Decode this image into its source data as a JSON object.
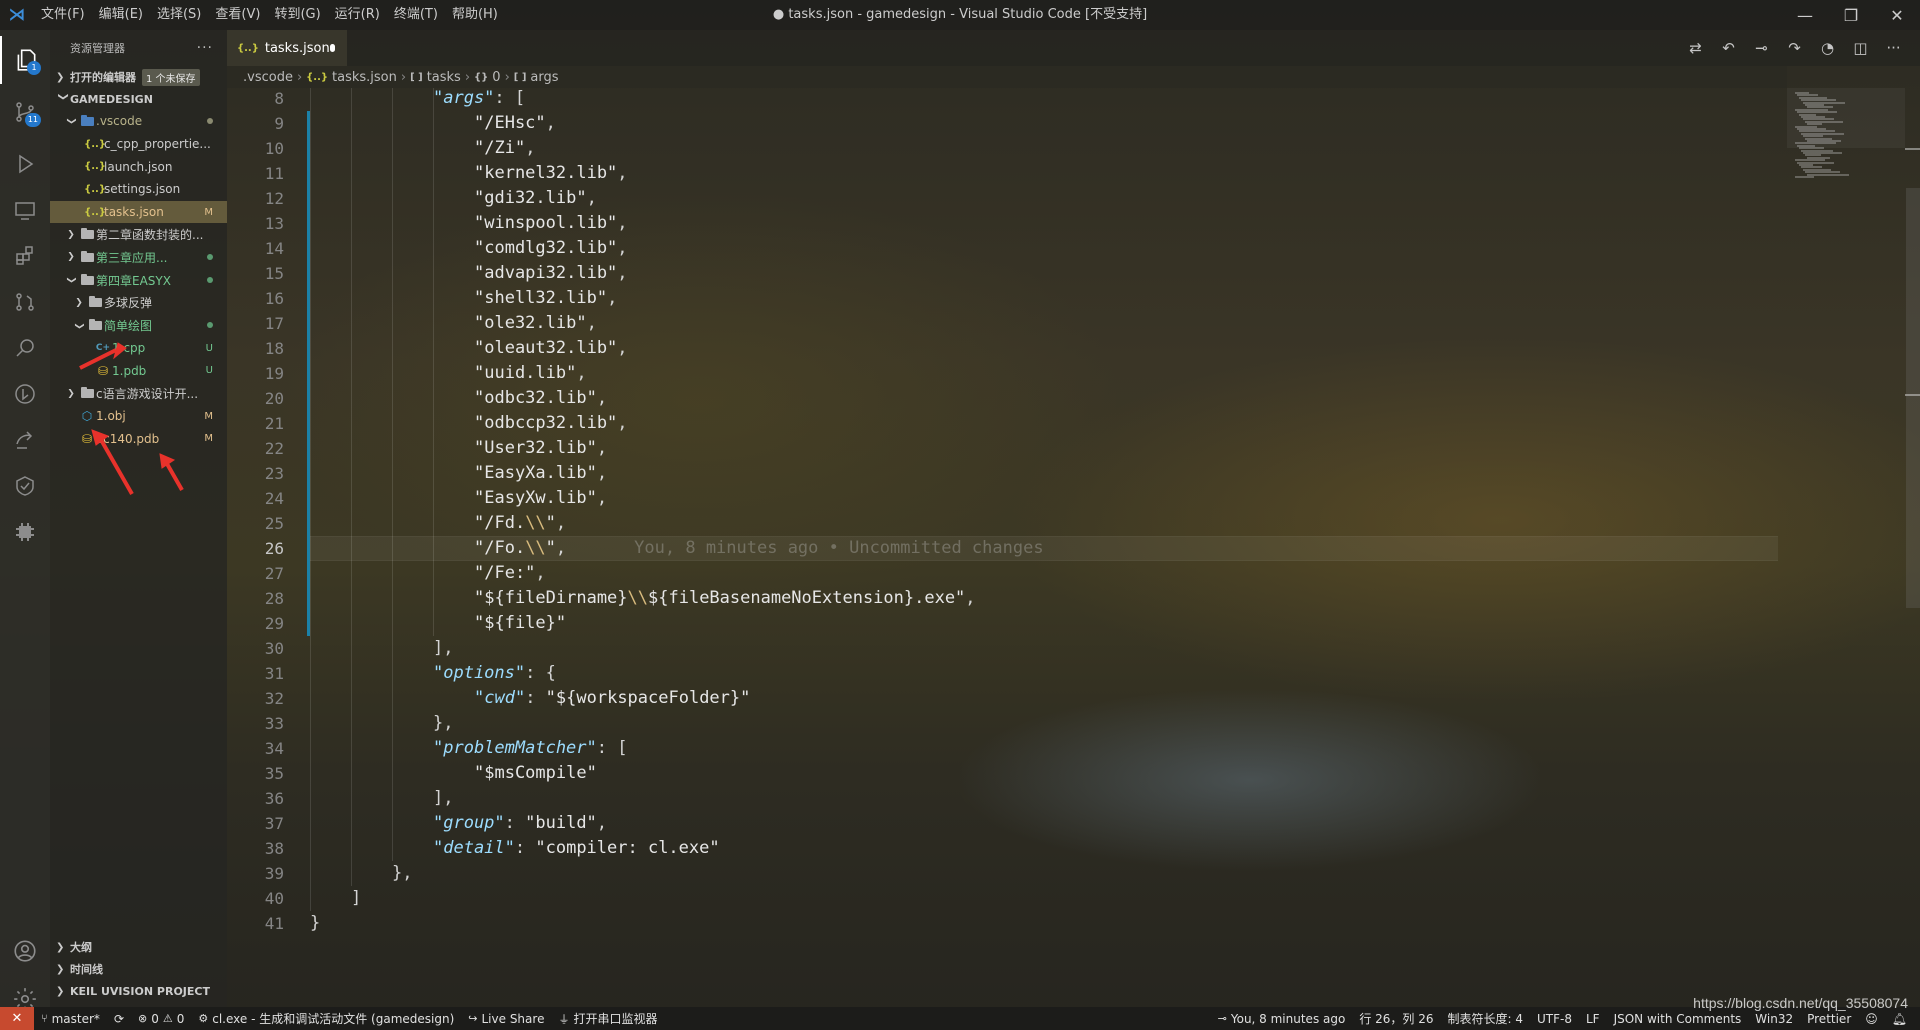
{
  "titlebar": {
    "menu": [
      "文件(F)",
      "编辑(E)",
      "选择(S)",
      "查看(V)",
      "转到(G)",
      "运行(R)",
      "终端(T)",
      "帮助(H)"
    ],
    "title": "● tasks.json - gamedesign - Visual Studio Code [不受支持]"
  },
  "activity": {
    "scm_badge": "1",
    "source_badge": "11"
  },
  "sidebar": {
    "title": "资源管理器",
    "open_editors": "打开的编辑器",
    "unsaved_badge": "1 个未保存",
    "workspace": "GAMEDESIGN",
    "tree": [
      {
        "label": ".vscode",
        "status": "",
        "indent": 1,
        "kind": "folder-vs",
        "open": true,
        "color": "c-folder-mod",
        "dot": true
      },
      {
        "label": "c_cpp_propertie...",
        "status": "",
        "indent": 2,
        "kind": "json",
        "color": ""
      },
      {
        "label": "launch.json",
        "status": "",
        "indent": 2,
        "kind": "json",
        "color": ""
      },
      {
        "label": "settings.json",
        "status": "",
        "indent": 2,
        "kind": "json",
        "color": ""
      },
      {
        "label": "tasks.json",
        "status": "M",
        "indent": 2,
        "kind": "json",
        "color": "c-mod",
        "selected": true
      },
      {
        "label": "第二章函数封装的...",
        "status": "",
        "indent": 1,
        "kind": "folder",
        "open": false,
        "color": ""
      },
      {
        "label": "第三章应用...",
        "status": "",
        "indent": 1,
        "kind": "folder",
        "open": false,
        "color": "c-green",
        "dot": true
      },
      {
        "label": "第四章EASYX",
        "status": "",
        "indent": 1,
        "kind": "folder",
        "open": true,
        "color": "c-green",
        "dot": true
      },
      {
        "label": "多球反弹",
        "status": "",
        "indent": 2,
        "kind": "folder",
        "open": false,
        "color": ""
      },
      {
        "label": "简单绘图",
        "status": "",
        "indent": 2,
        "kind": "folder",
        "open": true,
        "color": "c-green",
        "dot": true
      },
      {
        "label": "1.cpp",
        "status": "U",
        "indent": 3,
        "kind": "cpp",
        "color": "c-green"
      },
      {
        "label": "1.pdb",
        "status": "U",
        "indent": 3,
        "kind": "pdb",
        "color": "c-green"
      },
      {
        "label": "c语言游戏设计开...",
        "status": "",
        "indent": 1,
        "kind": "folder",
        "open": false,
        "color": ""
      },
      {
        "label": "1.obj",
        "status": "M",
        "indent": 1,
        "kind": "obj",
        "color": "c-mod"
      },
      {
        "label": "vc140.pdb",
        "status": "M",
        "indent": 1,
        "kind": "pdb",
        "color": "c-mod"
      }
    ],
    "bottom_sections": [
      "大纲",
      "时间线",
      "KEIL UVISION PROJECT"
    ]
  },
  "tab": {
    "label": "tasks.json"
  },
  "breadcrumbs": [
    ".vscode",
    "tasks.json",
    "tasks",
    "0",
    "args"
  ],
  "editor": {
    "cursor_line": 26,
    "blame_text": "You, 8 minutes ago • Uncommitted changes",
    "lines": [
      {
        "n": 8,
        "indent": 3,
        "parts": [
          [
            "k",
            "\"args\""
          ],
          [
            "p",
            ": ["
          ]
        ]
      },
      {
        "n": 9,
        "indent": 4,
        "parts": [
          [
            "s",
            "\"/EHsc\""
          ],
          [
            "p",
            ","
          ]
        ]
      },
      {
        "n": 10,
        "indent": 4,
        "parts": [
          [
            "s",
            "\"/Zi\""
          ],
          [
            "p",
            ","
          ]
        ]
      },
      {
        "n": 11,
        "indent": 4,
        "parts": [
          [
            "s",
            "\"kernel32.lib\""
          ],
          [
            "p",
            ","
          ]
        ]
      },
      {
        "n": 12,
        "indent": 4,
        "parts": [
          [
            "s",
            "\"gdi32.lib\""
          ],
          [
            "p",
            ","
          ]
        ]
      },
      {
        "n": 13,
        "indent": 4,
        "parts": [
          [
            "s",
            "\"winspool.lib\""
          ],
          [
            "p",
            ","
          ]
        ]
      },
      {
        "n": 14,
        "indent": 4,
        "parts": [
          [
            "s",
            "\"comdlg32.lib\""
          ],
          [
            "p",
            ","
          ]
        ]
      },
      {
        "n": 15,
        "indent": 4,
        "parts": [
          [
            "s",
            "\"advapi32.lib\""
          ],
          [
            "p",
            ","
          ]
        ]
      },
      {
        "n": 16,
        "indent": 4,
        "parts": [
          [
            "s",
            "\"shell32.lib\""
          ],
          [
            "p",
            ","
          ]
        ]
      },
      {
        "n": 17,
        "indent": 4,
        "parts": [
          [
            "s",
            "\"ole32.lib\""
          ],
          [
            "p",
            ","
          ]
        ]
      },
      {
        "n": 18,
        "indent": 4,
        "parts": [
          [
            "s",
            "\"oleaut32.lib\""
          ],
          [
            "p",
            ","
          ]
        ]
      },
      {
        "n": 19,
        "indent": 4,
        "parts": [
          [
            "s",
            "\"uuid.lib\""
          ],
          [
            "p",
            ","
          ]
        ]
      },
      {
        "n": 20,
        "indent": 4,
        "parts": [
          [
            "s",
            "\"odbc32.lib\""
          ],
          [
            "p",
            ","
          ]
        ]
      },
      {
        "n": 21,
        "indent": 4,
        "parts": [
          [
            "s",
            "\"odbccp32.lib\""
          ],
          [
            "p",
            ","
          ]
        ]
      },
      {
        "n": 22,
        "indent": 4,
        "parts": [
          [
            "s",
            "\"User32.lib\""
          ],
          [
            "p",
            ","
          ]
        ]
      },
      {
        "n": 23,
        "indent": 4,
        "parts": [
          [
            "s",
            "\"EasyXa.lib\""
          ],
          [
            "p",
            ","
          ]
        ]
      },
      {
        "n": 24,
        "indent": 4,
        "parts": [
          [
            "s",
            "\"EasyXw.lib\""
          ],
          [
            "p",
            ","
          ]
        ]
      },
      {
        "n": 25,
        "indent": 4,
        "parts": [
          [
            "s",
            "\"/Fd."
          ],
          [
            "e",
            "\\\\"
          ],
          [
            "s",
            "\""
          ],
          [
            "p",
            ","
          ]
        ]
      },
      {
        "n": 26,
        "indent": 4,
        "parts": [
          [
            "s",
            "\"/Fo."
          ],
          [
            "e",
            "\\\\"
          ],
          [
            "s",
            "\""
          ],
          [
            "p",
            ","
          ]
        ]
      },
      {
        "n": 27,
        "indent": 4,
        "parts": [
          [
            "s",
            "\"/Fe:\""
          ],
          [
            "p",
            ","
          ]
        ]
      },
      {
        "n": 28,
        "indent": 4,
        "parts": [
          [
            "s",
            "\"${fileDirname}"
          ],
          [
            "e",
            "\\\\"
          ],
          [
            "s",
            "${fileBasenameNoExtension}.exe\""
          ],
          [
            "p",
            ","
          ]
        ]
      },
      {
        "n": 29,
        "indent": 4,
        "parts": [
          [
            "s",
            "\"${file}\""
          ]
        ]
      },
      {
        "n": 30,
        "indent": 3,
        "parts": [
          [
            "p",
            "],"
          ]
        ]
      },
      {
        "n": 31,
        "indent": 3,
        "parts": [
          [
            "k",
            "\"options\""
          ],
          [
            "p",
            ": {"
          ]
        ]
      },
      {
        "n": 32,
        "indent": 4,
        "parts": [
          [
            "k",
            "\"cwd\""
          ],
          [
            "p",
            ": "
          ],
          [
            "s",
            "\"${workspaceFolder}\""
          ]
        ]
      },
      {
        "n": 33,
        "indent": 3,
        "parts": [
          [
            "p",
            "},"
          ]
        ]
      },
      {
        "n": 34,
        "indent": 3,
        "parts": [
          [
            "k",
            "\"problemMatcher\""
          ],
          [
            "p",
            ": ["
          ]
        ]
      },
      {
        "n": 35,
        "indent": 4,
        "parts": [
          [
            "s",
            "\"$msCompile\""
          ]
        ]
      },
      {
        "n": 36,
        "indent": 3,
        "parts": [
          [
            "p",
            "],"
          ]
        ]
      },
      {
        "n": 37,
        "indent": 3,
        "parts": [
          [
            "k",
            "\"group\""
          ],
          [
            "p",
            ": "
          ],
          [
            "s",
            "\"build\""
          ],
          [
            "p",
            ","
          ]
        ]
      },
      {
        "n": 38,
        "indent": 3,
        "parts": [
          [
            "k",
            "\"detail\""
          ],
          [
            "p",
            ": "
          ],
          [
            "s",
            "\"compiler: cl.exe\""
          ]
        ]
      },
      {
        "n": 39,
        "indent": 2,
        "parts": [
          [
            "p",
            "},"
          ]
        ]
      },
      {
        "n": 40,
        "indent": 1,
        "parts": [
          [
            "p",
            "]"
          ]
        ]
      },
      {
        "n": 41,
        "indent": 0,
        "parts": [
          [
            "p",
            "}"
          ]
        ]
      }
    ]
  },
  "statusbar": {
    "branch": "master*",
    "errors": "0",
    "warnings": "0",
    "task": "cl.exe - 生成和调试活动文件 (gamedesign)",
    "live_share": "Live Share",
    "serial": "打开串口监视器",
    "blame": "You, 8 minutes ago",
    "position": "行 26，列 26",
    "tab_size": "制表符长度: 4",
    "encoding": "UTF-8",
    "eol": "LF",
    "language": "JSON with Comments",
    "platform": "Win32",
    "formatter": "Prettier"
  },
  "watermark": "https://blog.csdn.net/qq_35508074"
}
